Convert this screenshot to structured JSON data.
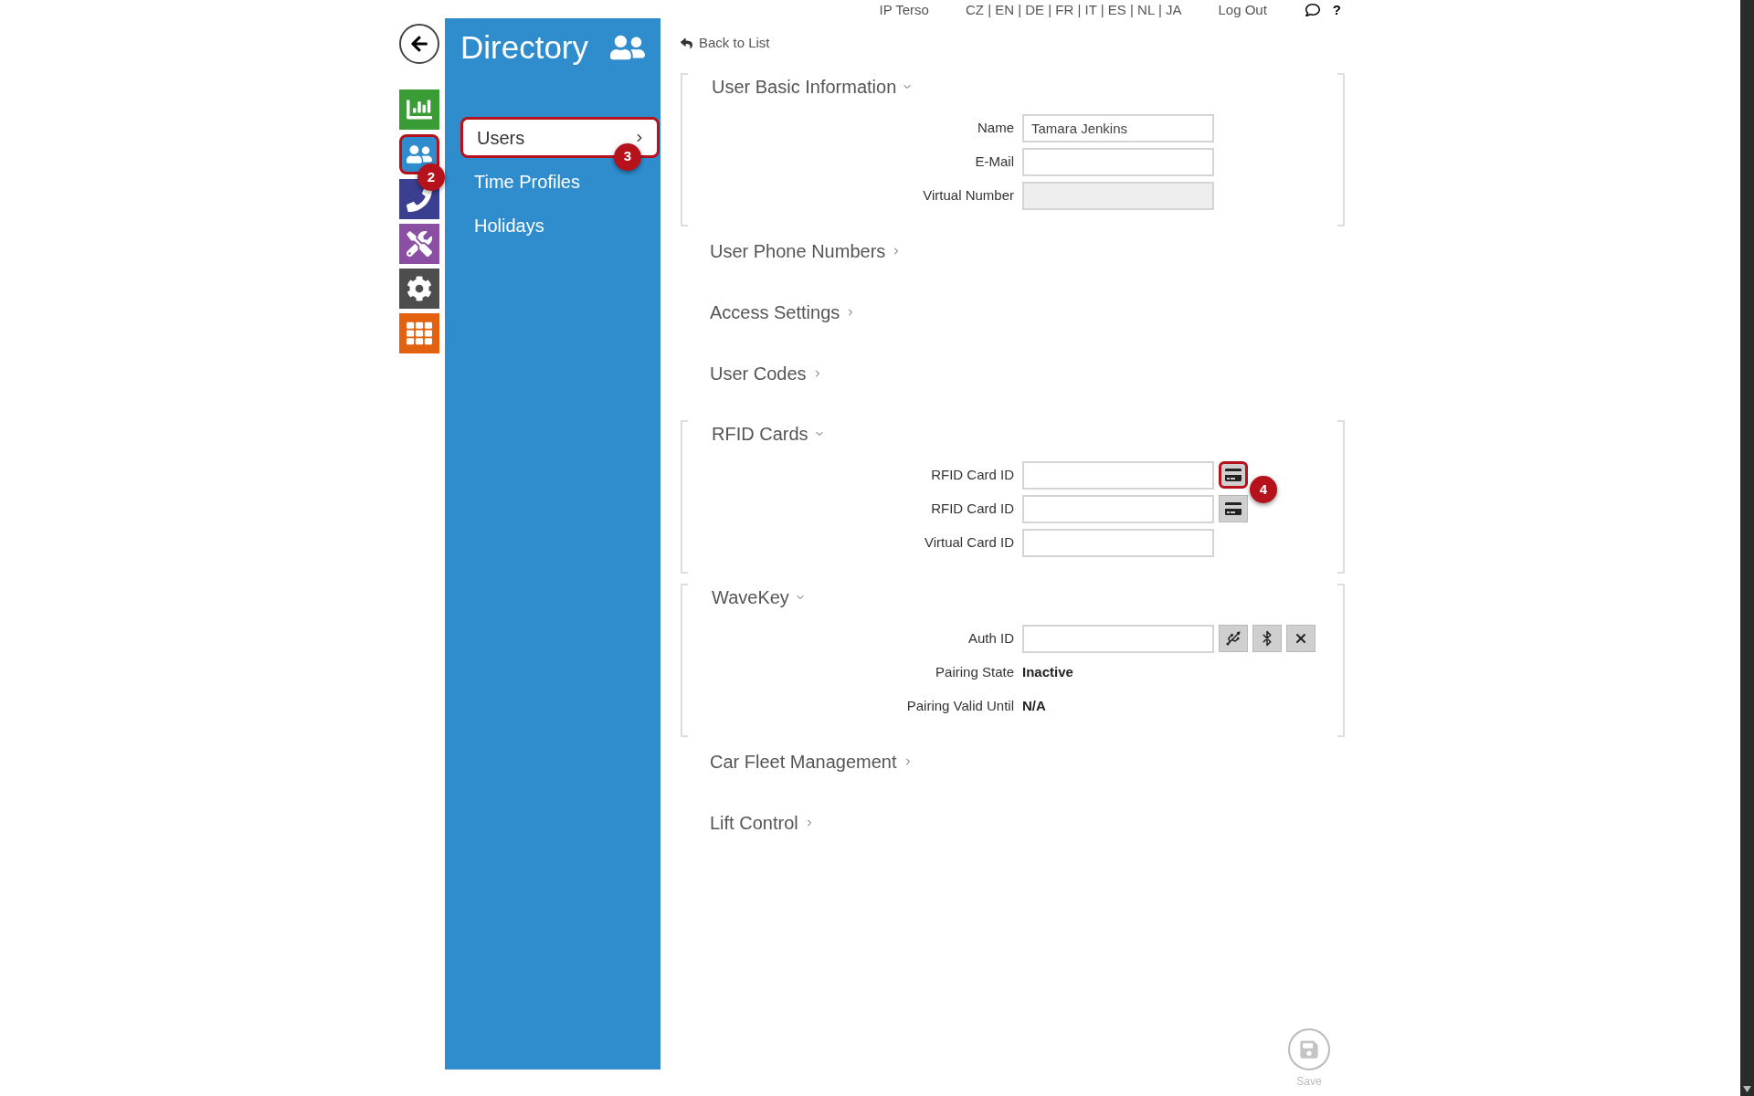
{
  "top_bar": {
    "device": "IP Terso",
    "languages": "CZ | EN | DE | FR | IT | ES | NL | JA",
    "logout": "Log Out",
    "help": "?"
  },
  "nav_icons": [
    {
      "kind": "status",
      "selected": false
    },
    {
      "kind": "directory",
      "selected": true,
      "callout": "2"
    },
    {
      "kind": "calls",
      "selected": false
    },
    {
      "kind": "hardware",
      "selected": false
    },
    {
      "kind": "system",
      "selected": false
    },
    {
      "kind": "services",
      "selected": false
    }
  ],
  "sidebar": {
    "title": "Directory",
    "items": [
      {
        "label": "Users",
        "selected": true,
        "callout": "3"
      },
      {
        "label": "Time Profiles",
        "selected": false
      },
      {
        "label": "Holidays",
        "selected": false
      }
    ]
  },
  "back_link": "Back to List",
  "sections": [
    {
      "title": "User Basic Information",
      "expanded": true,
      "fields": [
        {
          "label": "Name",
          "kind": "input",
          "value": "Tamara Jenkins"
        },
        {
          "label": "E-Mail",
          "kind": "input"
        },
        {
          "label": "Virtual Number",
          "kind": "disabled_input"
        }
      ]
    },
    {
      "title": "User Phone Numbers",
      "expanded": false
    },
    {
      "title": "Access Settings",
      "expanded": false
    },
    {
      "title": "User Codes",
      "expanded": false
    },
    {
      "title": "RFID Cards",
      "expanded": true,
      "fields": [
        {
          "label": "RFID Card ID",
          "kind": "input",
          "buttons": [
            {
              "kind": "card",
              "highlighted": true,
              "callout": "4"
            }
          ]
        },
        {
          "label": "RFID Card ID",
          "kind": "input",
          "buttons": [
            {
              "kind": "card",
              "highlighted": false
            }
          ]
        },
        {
          "label": "Virtual Card ID",
          "kind": "input"
        }
      ]
    },
    {
      "title": "WaveKey",
      "expanded": true,
      "fields": [
        {
          "label": "Auth ID",
          "kind": "input",
          "buttons": [
            {
              "kind": "usb",
              "highlighted": false
            },
            {
              "kind": "bluetooth",
              "highlighted": false
            },
            {
              "kind": "clear",
              "highlighted": false
            }
          ]
        },
        {
          "label": "Pairing State",
          "kind": "text",
          "value": "Inactive"
        },
        {
          "label": "Pairing Valid Until",
          "kind": "text",
          "value": "N/A"
        }
      ]
    },
    {
      "title": "Car Fleet Management",
      "expanded": false
    },
    {
      "title": "Lift Control",
      "expanded": false
    }
  ],
  "save": {
    "label": "Save",
    "disabled": true
  }
}
